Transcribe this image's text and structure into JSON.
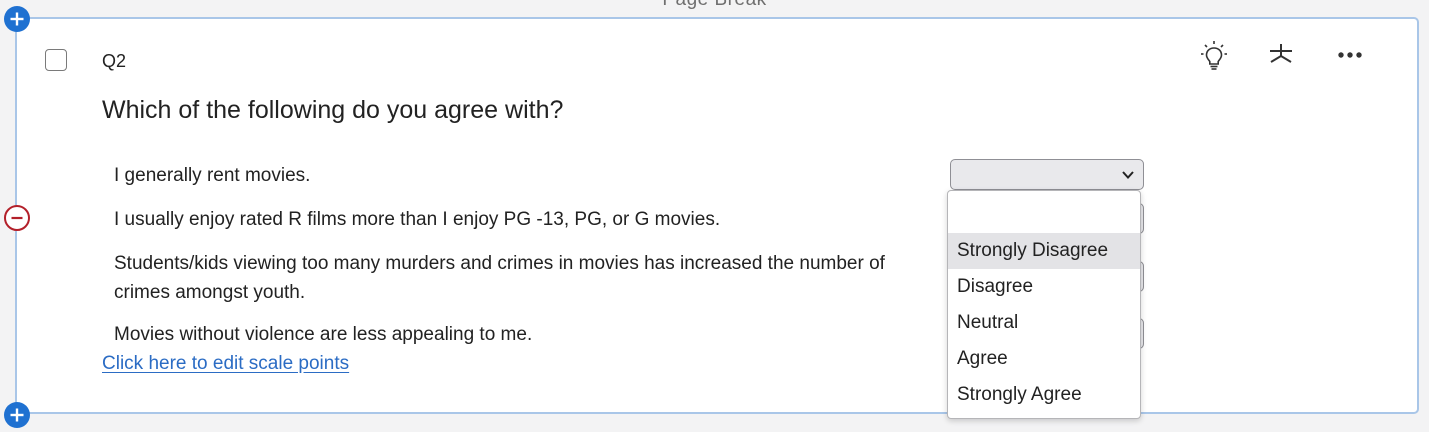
{
  "page_break_label": "Page Break",
  "question": {
    "number": "Q2",
    "text": "Which of the following do you agree with?",
    "statements": [
      "I generally rent movies.",
      "I usually enjoy rated R films more than I enjoy PG -13, PG, or G movies.",
      "Students/kids viewing too many murders and crimes in movies has increased the number of crimes amongst youth.",
      "Movies without violence are less appealing to me."
    ],
    "edit_scale_link": "Click here to edit scale points"
  },
  "dropdown": {
    "selected": "",
    "options": [
      "Strongly Disagree",
      "Disagree",
      "Neutral",
      "Agree",
      "Strongly Agree"
    ],
    "highlighted": "Strongly Disagree"
  },
  "colors": {
    "accent_blue": "#1f71d1",
    "remove_red": "#b3202a",
    "card_border": "#a9c6e8",
    "link": "#2b6cc4"
  },
  "icons": {
    "add_top": "plus-icon",
    "remove": "minus-icon",
    "add_bottom": "plus-icon",
    "suggest": "lightbulb-icon",
    "required": "asterisk-icon",
    "more": "ellipsis-icon"
  }
}
